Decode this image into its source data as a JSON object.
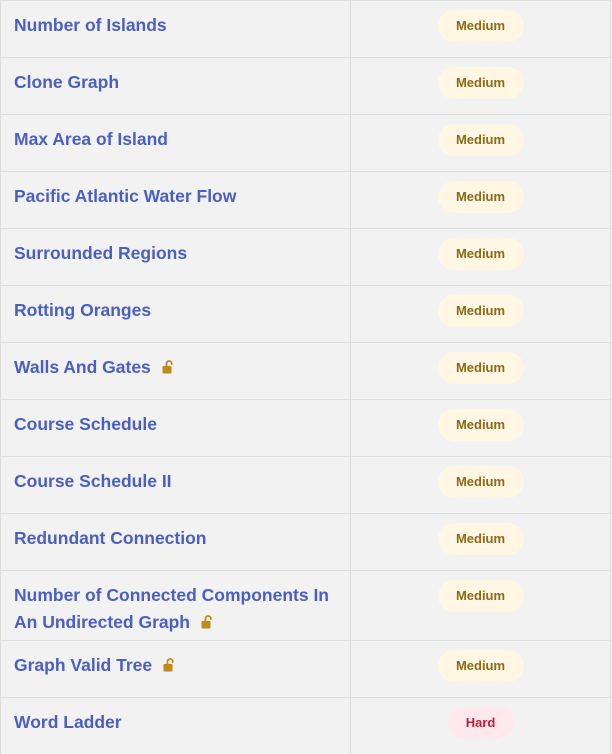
{
  "colors": {
    "link": "#4a5fc1",
    "medium_bg": "#fff7e3",
    "medium_text": "#8a6a16",
    "hard_bg": "#ffe9ee",
    "hard_text": "#c41e3a",
    "lock": "#c08a1a"
  },
  "problems": [
    {
      "title": "Number of Islands",
      "difficulty": "Medium",
      "locked": false
    },
    {
      "title": "Clone Graph",
      "difficulty": "Medium",
      "locked": false
    },
    {
      "title": "Max Area of Island",
      "difficulty": "Medium",
      "locked": false
    },
    {
      "title": "Pacific Atlantic Water Flow",
      "difficulty": "Medium",
      "locked": false
    },
    {
      "title": "Surrounded Regions",
      "difficulty": "Medium",
      "locked": false
    },
    {
      "title": "Rotting Oranges",
      "difficulty": "Medium",
      "locked": false
    },
    {
      "title": "Walls And Gates",
      "difficulty": "Medium",
      "locked": true,
      "icon": "lock-open-icon"
    },
    {
      "title": "Course Schedule",
      "difficulty": "Medium",
      "locked": false
    },
    {
      "title": "Course Schedule II",
      "difficulty": "Medium",
      "locked": false
    },
    {
      "title": "Redundant Connection",
      "difficulty": "Medium",
      "locked": false
    },
    {
      "title": "Number of Connected Components In An Undirected Graph",
      "difficulty": "Medium",
      "locked": true,
      "icon": "lock-open-icon"
    },
    {
      "title": "Graph Valid Tree",
      "difficulty": "Medium",
      "locked": true,
      "icon": "lock-open-icon"
    },
    {
      "title": "Word Ladder",
      "difficulty": "Hard",
      "locked": false
    }
  ]
}
